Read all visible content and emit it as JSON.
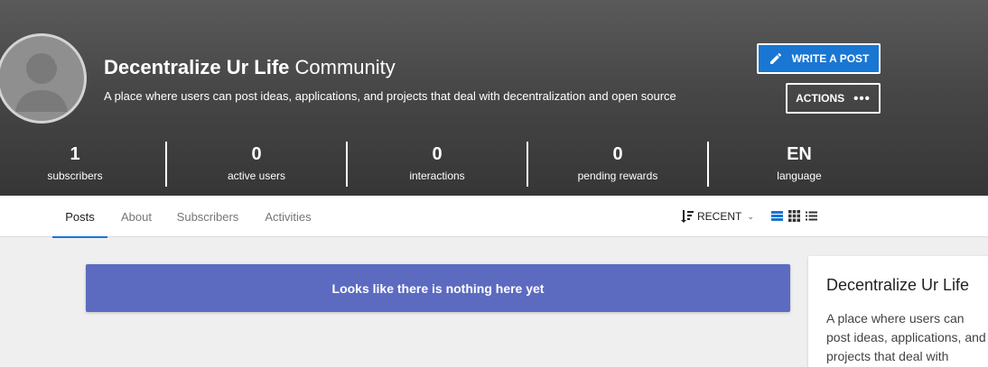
{
  "community": {
    "name_bold": "Decentralize Ur Life",
    "name_light": "Community",
    "description": "A place where users can post ideas, applications, and projects that deal with decentralization and open source"
  },
  "buttons": {
    "write_post": "WRITE A POST",
    "actions": "ACTIONS"
  },
  "stats": [
    {
      "value": "1",
      "label": "subscribers"
    },
    {
      "value": "0",
      "label": "active users"
    },
    {
      "value": "0",
      "label": "interactions"
    },
    {
      "value": "0",
      "label": "pending rewards"
    },
    {
      "value": "EN",
      "label": "language"
    }
  ],
  "tabs": [
    "Posts",
    "About",
    "Subscribers",
    "Activities"
  ],
  "active_tab": "Posts",
  "sort": {
    "label": "RECENT"
  },
  "view_modes": [
    "list-view-icon",
    "grid-view-icon",
    "compact-list-icon"
  ],
  "empty_message": "Looks like there is nothing here yet",
  "sidebar": {
    "title": "Decentralize Ur Life",
    "description": "A place where users can post ideas, applications, and projects that deal with"
  },
  "colors": {
    "primary": "#1976d2",
    "empty_banner": "#5c6bc0",
    "hero_dark": "#363636"
  }
}
